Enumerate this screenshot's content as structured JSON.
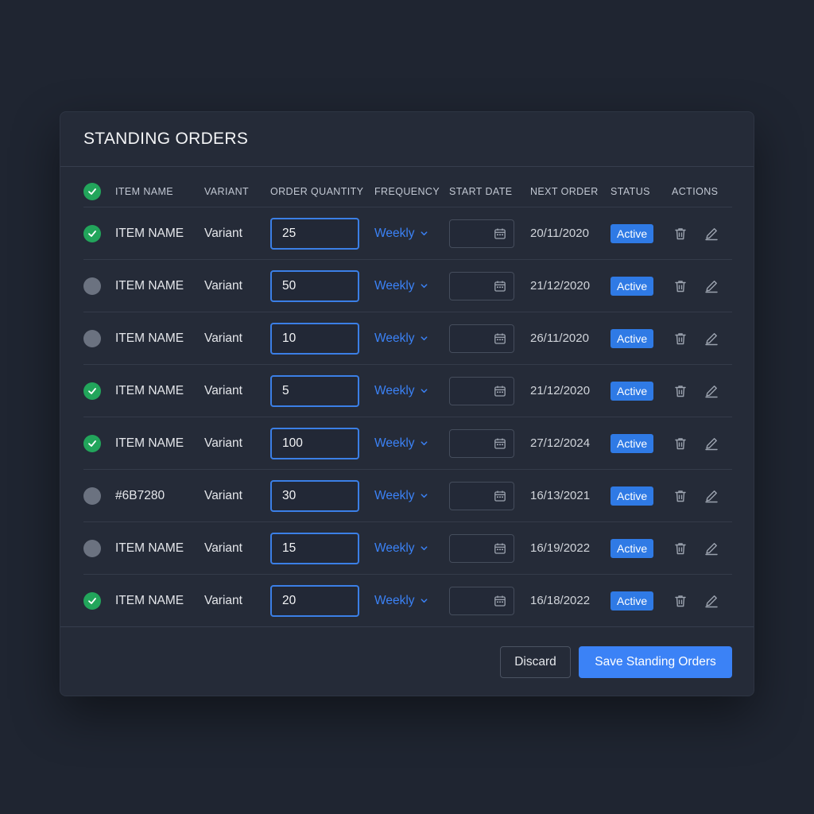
{
  "panel": {
    "title": "STANDING ORDERS"
  },
  "columns": {
    "item_name": "ITEM NAME",
    "variant": "VARIANT",
    "order_quantity": "ORDER QUANTITY",
    "frequency": "FREQUENCY",
    "start_date": "START DATE",
    "next_order": "NEXT ORDER",
    "status": "STATUS",
    "actions": "ACTIONS"
  },
  "header_checked": true,
  "rows": [
    {
      "checked": true,
      "item_name": "ITEM NAME",
      "variant": "Variant",
      "quantity": "25",
      "frequency": "Weekly",
      "next_order": "20/11/2020",
      "status": "Active"
    },
    {
      "checked": false,
      "item_name": "ITEM NAME",
      "variant": "Variant",
      "quantity": "50",
      "frequency": "Weekly",
      "next_order": "21/12/2020",
      "status": "Active"
    },
    {
      "checked": false,
      "item_name": "ITEM NAME",
      "variant": "Variant",
      "quantity": "10",
      "frequency": "Weekly",
      "next_order": "26/11/2020",
      "status": "Active"
    },
    {
      "checked": true,
      "item_name": "ITEM NAME",
      "variant": "Variant",
      "quantity": "5",
      "frequency": "Weekly",
      "next_order": "21/12/2020",
      "status": "Active"
    },
    {
      "checked": true,
      "item_name": "ITEM NAME",
      "variant": "Variant",
      "quantity": "100",
      "frequency": "Weekly",
      "next_order": "27/12/2024",
      "status": "Active"
    },
    {
      "checked": false,
      "item_name": "#6B7280",
      "variant": "Variant",
      "quantity": "30",
      "frequency": "Weekly",
      "next_order": "16/13/2021",
      "status": "Active"
    },
    {
      "checked": false,
      "item_name": "ITEM NAME",
      "variant": "Variant",
      "quantity": "15",
      "frequency": "Weekly",
      "next_order": "16/19/2022",
      "status": "Active"
    },
    {
      "checked": true,
      "item_name": "ITEM NAME",
      "variant": "Variant",
      "quantity": "20",
      "frequency": "Weekly",
      "next_order": "16/18/2022",
      "status": "Active"
    }
  ],
  "footer": {
    "discard_label": "Discard",
    "save_label": "Save Standing Orders"
  },
  "icons": {
    "row_check": "check-icon",
    "frequency_dropdown": "chevron-down-icon",
    "start_date": "calendar-icon",
    "delete": "trash-icon",
    "edit": "pencil-icon"
  },
  "colors": {
    "background": "#1f2531",
    "panel": "#252b38",
    "accent": "#3b82f6",
    "checked": "#22a55b",
    "unchecked": "#6b7280",
    "badge": "#2f7ae5"
  }
}
